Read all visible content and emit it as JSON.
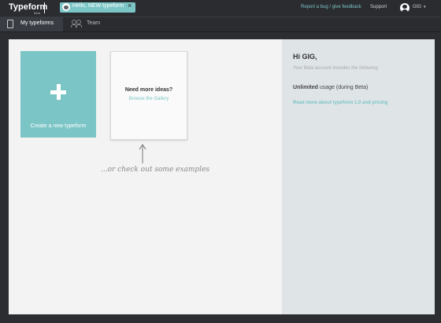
{
  "header": {
    "logo": "Typeform",
    "logo_sub": "Beta",
    "tab_title": "Hello, NEW typeform",
    "feedback_link": "Report a bug / give feedback",
    "support_link": "Support",
    "user_name": "GIG",
    "user_chevron": "▾"
  },
  "nav": {
    "my_typeforms": "My typeforms",
    "team": "Team"
  },
  "main": {
    "create_label": "Create a new typeform",
    "ideas_title": "Need more ideas?",
    "ideas_link": "Browse the Gallery",
    "examples_text": "...or check out some examples"
  },
  "sidebar": {
    "greeting": "Hi GIG,",
    "beta_info": "Your Beta account includes the following:",
    "unlimited_bold": "Unlimited",
    "unlimited_rest": "usage (during Beta)",
    "read_more": "Read more about typeform 1.0 and pricing"
  },
  "colors": {
    "accent": "#7cc5c6",
    "topbar": "#2a2c30",
    "sidebar_bg": "#dfe4e6"
  }
}
